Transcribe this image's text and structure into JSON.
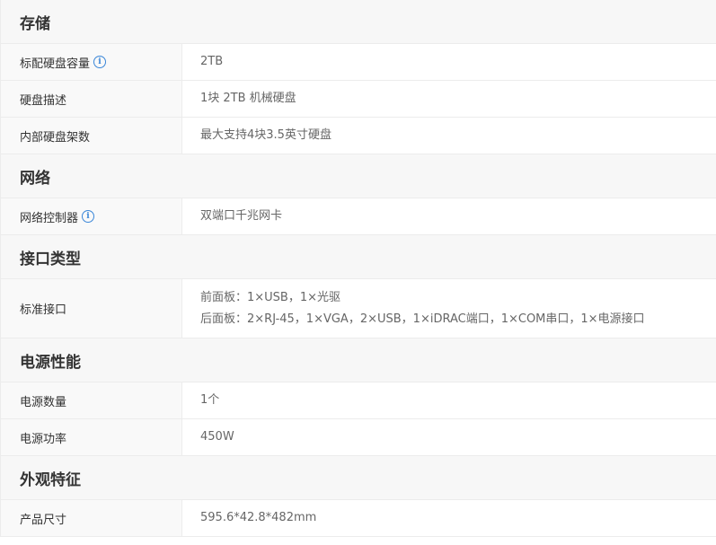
{
  "sections": [
    {
      "title": "存储",
      "rows": [
        {
          "label": "标配硬盘容量",
          "info": true,
          "values": [
            "2TB"
          ]
        },
        {
          "label": "硬盘描述",
          "info": false,
          "values": [
            "1块 2TB 机械硬盘"
          ]
        },
        {
          "label": "内部硬盘架数",
          "info": false,
          "values": [
            "最大支持4块3.5英寸硬盘"
          ]
        }
      ]
    },
    {
      "title": "网络",
      "rows": [
        {
          "label": "网络控制器",
          "info": true,
          "values": [
            "双端口千兆网卡"
          ]
        }
      ]
    },
    {
      "title": "接口类型",
      "rows": [
        {
          "label": "标准接口",
          "info": false,
          "values": [
            "前面板：1×USB，1×光驱",
            "后面板：2×RJ-45，1×VGA，2×USB，1×iDRAC端口，1×COM串口，1×电源接口"
          ]
        }
      ]
    },
    {
      "title": "电源性能",
      "rows": [
        {
          "label": "电源数量",
          "info": false,
          "values": [
            "1个"
          ]
        },
        {
          "label": "电源功率",
          "info": false,
          "values": [
            "450W"
          ]
        }
      ]
    },
    {
      "title": "外观特征",
      "rows": [
        {
          "label": "产品尺寸",
          "info": false,
          "values": [
            "595.6*42.8*482mm"
          ]
        }
      ]
    }
  ],
  "icons": {
    "info_glyph": "i",
    "info_color": "#3a86d8"
  }
}
